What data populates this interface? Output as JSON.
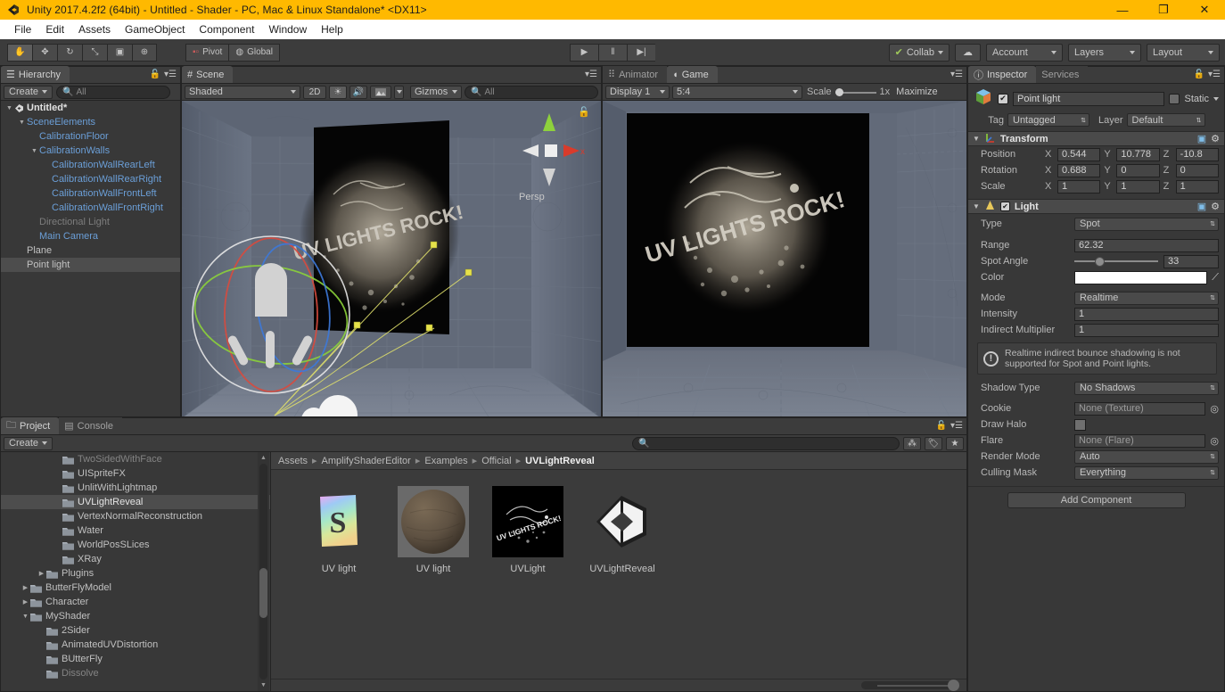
{
  "window": {
    "title": "Unity 2017.4.2f2 (64bit) - Untitled - Shader - PC, Mac & Linux Standalone* <DX11>",
    "app_icon": "unity-logo-icon",
    "minimize": "—",
    "maximize": "❐",
    "close": "✕",
    "accent": "#FFB900"
  },
  "menu": {
    "items": [
      {
        "label": "File"
      },
      {
        "label": "Edit"
      },
      {
        "label": "Assets"
      },
      {
        "label": "GameObject"
      },
      {
        "label": "Component"
      },
      {
        "label": "Window"
      },
      {
        "label": "Help"
      }
    ]
  },
  "toolbar": {
    "transform_tools": [
      {
        "name": "hand-tool",
        "glyph": "✋",
        "active": true
      },
      {
        "name": "move-tool",
        "glyph": "✥",
        "active": false
      },
      {
        "name": "rotate-tool",
        "glyph": "↻",
        "active": false
      },
      {
        "name": "scale-tool",
        "glyph": "⤡",
        "active": false
      },
      {
        "name": "rect-tool",
        "glyph": "▣",
        "active": false
      },
      {
        "name": "transform-tool",
        "glyph": "⊕",
        "active": false
      }
    ],
    "pivot_label": "Pivot",
    "global_label": "Global",
    "play_label": "▶",
    "pause_label": "‖",
    "step_label": "▶|",
    "collab_label": "Collab",
    "cloud_label": "☁",
    "account_label": "Account",
    "layers_label": "Layers",
    "layout_label": "Layout"
  },
  "hierarchy": {
    "tab_label": "Hierarchy",
    "create_label": "Create",
    "search_placeholder": "All",
    "rows": [
      {
        "label": "Untitled*",
        "depth": 0,
        "arrow": "▼",
        "style": "root",
        "icon": "scene-icon"
      },
      {
        "label": "SceneElements",
        "depth": 1,
        "arrow": "▼",
        "style": "link"
      },
      {
        "label": "CalibrationFloor",
        "depth": 2,
        "arrow": "",
        "style": "link"
      },
      {
        "label": "CalibrationWalls",
        "depth": 2,
        "arrow": "▼",
        "style": "link"
      },
      {
        "label": "CalibrationWallRearLeft",
        "depth": 3,
        "arrow": "",
        "style": "link"
      },
      {
        "label": "CalibrationWallRearRight",
        "depth": 3,
        "arrow": "",
        "style": "link"
      },
      {
        "label": "CalibrationWallFrontLeft",
        "depth": 3,
        "arrow": "",
        "style": "link"
      },
      {
        "label": "CalibrationWallFrontRight",
        "depth": 3,
        "arrow": "",
        "style": "link"
      },
      {
        "label": "Directional Light",
        "depth": 2,
        "arrow": "",
        "style": "dim"
      },
      {
        "label": "Main Camera",
        "depth": 2,
        "arrow": "",
        "style": "link"
      },
      {
        "label": "Plane",
        "depth": 1,
        "arrow": "",
        "style": "plain"
      },
      {
        "label": "Point light",
        "depth": 1,
        "arrow": "",
        "style": "plain",
        "selected": true
      }
    ]
  },
  "scene": {
    "tab_label": "Scene",
    "shading_mode": "Shaded",
    "mode_2d": "2D",
    "lighting_icon": "☀",
    "audio_icon": "🔊",
    "effects_icon": "⛰",
    "gizmos_label": "Gizmos",
    "search_placeholder": "All",
    "gizmo_axis_y": "y",
    "gizmo_axis_x": "x",
    "persp_label": "Persp",
    "overlay_text": "UV LIGHTS ROCK!"
  },
  "game": {
    "animator_tab": "Animator",
    "game_tab": "Game",
    "display_label": "Display 1",
    "aspect_label": "5:4",
    "scale_label": "Scale",
    "scale_value": "1x",
    "maximize_label": "Maximize",
    "overlay_text": "UV LIGHTS ROCK!"
  },
  "inspector": {
    "tab_label": "Inspector",
    "services_tab": "Services",
    "object_name": "Point light",
    "object_enabled": true,
    "static_label": "Static",
    "tag_label": "Tag",
    "tag_value": "Untagged",
    "layer_label": "Layer",
    "layer_value": "Default",
    "transform": {
      "title": "Transform",
      "rows": [
        {
          "label": "Position",
          "x": "0.544",
          "y": "10.778",
          "z": "-10.8"
        },
        {
          "label": "Rotation",
          "x": "0.688",
          "y": "0",
          "z": "0"
        },
        {
          "label": "Scale",
          "x": "1",
          "y": "1",
          "z": "1"
        }
      ],
      "axis_labels": [
        "X",
        "Y",
        "Z"
      ]
    },
    "light": {
      "title": "Light",
      "enabled": true,
      "type_label": "Type",
      "type_value": "Spot",
      "range_label": "Range",
      "range_value": "62.32",
      "spot_angle_label": "Spot Angle",
      "spot_angle_value": "33",
      "spot_angle_pct": 24,
      "color_label": "Color",
      "color_value": "#ffffff",
      "mode_label": "Mode",
      "mode_value": "Realtime",
      "intensity_label": "Intensity",
      "intensity_value": "1",
      "indirect_label": "Indirect Multiplier",
      "indirect_value": "1",
      "warning": "Realtime indirect bounce shadowing is not supported for Spot and Point lights.",
      "shadow_label": "Shadow Type",
      "shadow_value": "No Shadows",
      "cookie_label": "Cookie",
      "cookie_value": "None (Texture)",
      "draw_halo_label": "Draw Halo",
      "flare_label": "Flare",
      "flare_value": "None (Flare)",
      "render_mode_label": "Render Mode",
      "render_mode_value": "Auto",
      "culling_label": "Culling Mask",
      "culling_value": "Everything"
    },
    "add_component_label": "Add Component"
  },
  "project": {
    "tab_label": "Project",
    "console_tab": "Console",
    "create_label": "Create",
    "search_placeholder": "",
    "tree": [
      {
        "label": "TwoSidedWithFace",
        "depth": 3,
        "arrow": "",
        "clipped": true
      },
      {
        "label": "UISpriteFX",
        "depth": 3,
        "arrow": ""
      },
      {
        "label": "UnlitWithLightmap",
        "depth": 3,
        "arrow": ""
      },
      {
        "label": "UVLightReveal",
        "depth": 3,
        "arrow": "",
        "selected": true
      },
      {
        "label": "VertexNormalReconstruction",
        "depth": 3,
        "arrow": ""
      },
      {
        "label": "Water",
        "depth": 3,
        "arrow": ""
      },
      {
        "label": "WorldPosSLices",
        "depth": 3,
        "arrow": ""
      },
      {
        "label": "XRay",
        "depth": 3,
        "arrow": ""
      },
      {
        "label": "Plugins",
        "depth": 2,
        "arrow": "▶"
      },
      {
        "label": "ButterFlyModel",
        "depth": 1,
        "arrow": "▶"
      },
      {
        "label": "Character",
        "depth": 1,
        "arrow": "▶"
      },
      {
        "label": "MyShader",
        "depth": 1,
        "arrow": "▼"
      },
      {
        "label": "2Sider",
        "depth": 2,
        "arrow": ""
      },
      {
        "label": "AnimatedUVDistortion",
        "depth": 2,
        "arrow": ""
      },
      {
        "label": "BUtterFly",
        "depth": 2,
        "arrow": ""
      },
      {
        "label": "Dissolve",
        "depth": 2,
        "arrow": "",
        "clipped": true
      }
    ],
    "breadcrumb": [
      "Assets",
      "AmplifyShaderEditor",
      "Examples",
      "Official",
      "UVLightReveal"
    ],
    "breadcrumb_sep": "▸",
    "assets": [
      {
        "label": "UV light",
        "kind": "shader-thumbnail"
      },
      {
        "label": "UV light",
        "kind": "material-sphere-thumbnail"
      },
      {
        "label": "UVLight",
        "kind": "texture-thumbnail"
      },
      {
        "label": "UVLightReveal",
        "kind": "prefab-unity-thumbnail"
      }
    ]
  }
}
